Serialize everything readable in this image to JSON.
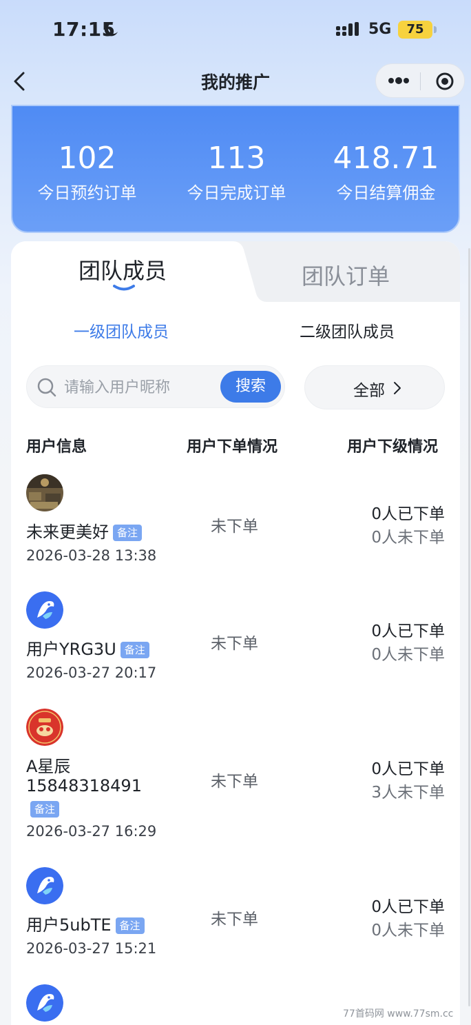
{
  "status_bar": {
    "time": "17:15",
    "network": "5G",
    "battery": "75"
  },
  "nav": {
    "title": "我的推广"
  },
  "stats": [
    {
      "value": "102",
      "label": "今日预约订单"
    },
    {
      "value": "113",
      "label": "今日完成订单"
    },
    {
      "value": "418.71",
      "label": "今日结算佣金"
    }
  ],
  "tabs": {
    "team_members": "团队成员",
    "team_orders": "团队订单"
  },
  "subtabs": {
    "level1": "一级团队成员",
    "level2": "二级团队成员"
  },
  "search": {
    "placeholder": "请输入用户昵称",
    "value": "",
    "button": "搜索"
  },
  "filter": {
    "label": "全部"
  },
  "table": {
    "headers": [
      "用户信息",
      "用户下单情况",
      "用户下级情况"
    ],
    "rows": [
      {
        "name": "未来更美好",
        "tag": "备注",
        "date": "2026-03-28 13:38",
        "order_status": "未下单",
        "ordered": "0人已下单",
        "not_ordered": "0人未下单",
        "avatar": "photo-avatar"
      },
      {
        "name": "用户YRG3U",
        "tag": "备注",
        "date": "2026-03-27 20:17",
        "order_status": "未下单",
        "ordered": "0人已下单",
        "not_ordered": "0人未下单",
        "avatar": "app-logo-avatar"
      },
      {
        "name": "A星辰",
        "name_line2": "15848318491",
        "tag": "备注",
        "date": "2026-03-27 16:29",
        "order_status": "未下单",
        "ordered": "0人已下单",
        "not_ordered": "3人未下单",
        "avatar": "red-festive-avatar"
      },
      {
        "name": "用户5ubTE",
        "tag": "备注",
        "date": "2026-03-27 15:21",
        "order_status": "未下单",
        "ordered": "0人已下单",
        "not_ordered": "0人未下单",
        "avatar": "app-logo-avatar"
      }
    ]
  },
  "watermark": "77首码网 www.77sm.cc",
  "colors": {
    "accent": "#3d7be8",
    "stats_bg": "#5b93f5",
    "tag_bg": "#7aa6f2"
  }
}
